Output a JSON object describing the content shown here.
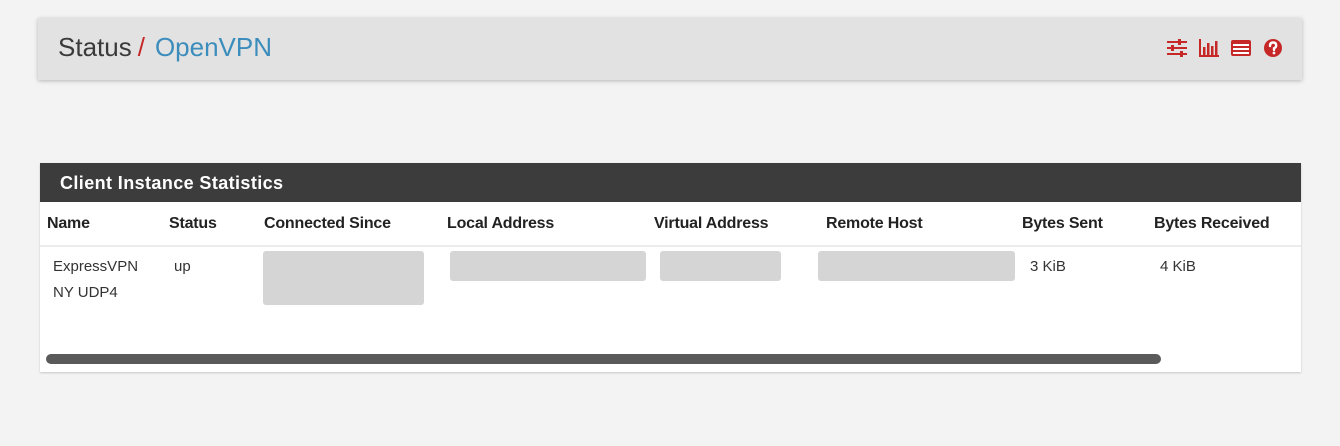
{
  "breadcrumb": {
    "root": "Status",
    "separator": "/",
    "current": "OpenVPN"
  },
  "header_icons": [
    "sliders-icon",
    "bar-chart-icon",
    "log-list-icon",
    "help-icon"
  ],
  "colors": {
    "accent_red": "#c62828",
    "link_blue": "#3c8dbc",
    "panel_heading_bg": "#3c3c3c"
  },
  "panel": {
    "title": "Client Instance Statistics",
    "columns": [
      "Name",
      "Status",
      "Connected Since",
      "Local Address",
      "Virtual Address",
      "Remote Host",
      "Bytes Sent",
      "Bytes Received"
    ],
    "rows": [
      {
        "name_line1": "ExpressVPN",
        "name_line2": "NY UDP4",
        "status": "up",
        "bytes_sent": "3 KiB",
        "bytes_received": "4 KiB"
      }
    ]
  }
}
